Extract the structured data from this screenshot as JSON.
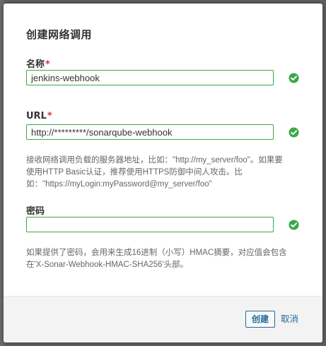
{
  "dialog": {
    "title": "创建网络调用"
  },
  "name_field": {
    "label": "名称",
    "required_mark": "*",
    "value": "jenkins-webhook",
    "status": "valid"
  },
  "url_field": {
    "label": "URL",
    "required_mark": "*",
    "value": "http://*********/sonarqube-webhook",
    "status": "valid",
    "help_line1": "接收网络调用负载的服务器地址，比如：\"http://my_server/foo\"。如果要",
    "help_line2": "使用HTTP Basic认证，推荐使用HTTPS防御中间人攻击。比",
    "help_line3": "如：\"https://myLogin:myPassword@my_server/foo\""
  },
  "secret_field": {
    "label": "密码",
    "value": "",
    "status": "valid",
    "help_line1": "如果提供了密码，会用来生成16进制（小写）HMAC摘要，对应值会包含",
    "help_line2": "在'X-Sonar-Webhook-HMAC-SHA256'头部。"
  },
  "footer": {
    "create_label": "创建",
    "cancel_label": "取消"
  },
  "icons": {
    "valid": "check-circle-icon"
  },
  "colors": {
    "valid_green": "#3aa847",
    "required_red": "#d4333f",
    "link_blue": "#236a97"
  }
}
